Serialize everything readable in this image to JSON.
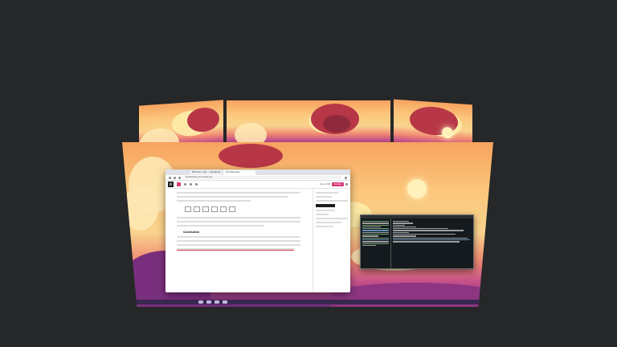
{
  "browser": {
    "tabs": [
      {
        "label": "Edit Post ‹ Site — WordPress"
      },
      {
        "label": "Add New Post"
      }
    ],
    "url": "localhost/wp-admin/post.php",
    "toolbar": {
      "save_label": "Save draft",
      "publish_label": "Publish"
    },
    "editor": {
      "heading": "Conclusion"
    }
  },
  "terminal": {
    "title": "Terminal"
  },
  "colors": {
    "desktop_bg": "#262728",
    "wp_accent": "#d63a7a",
    "terminal_bg": "#141a1d"
  }
}
